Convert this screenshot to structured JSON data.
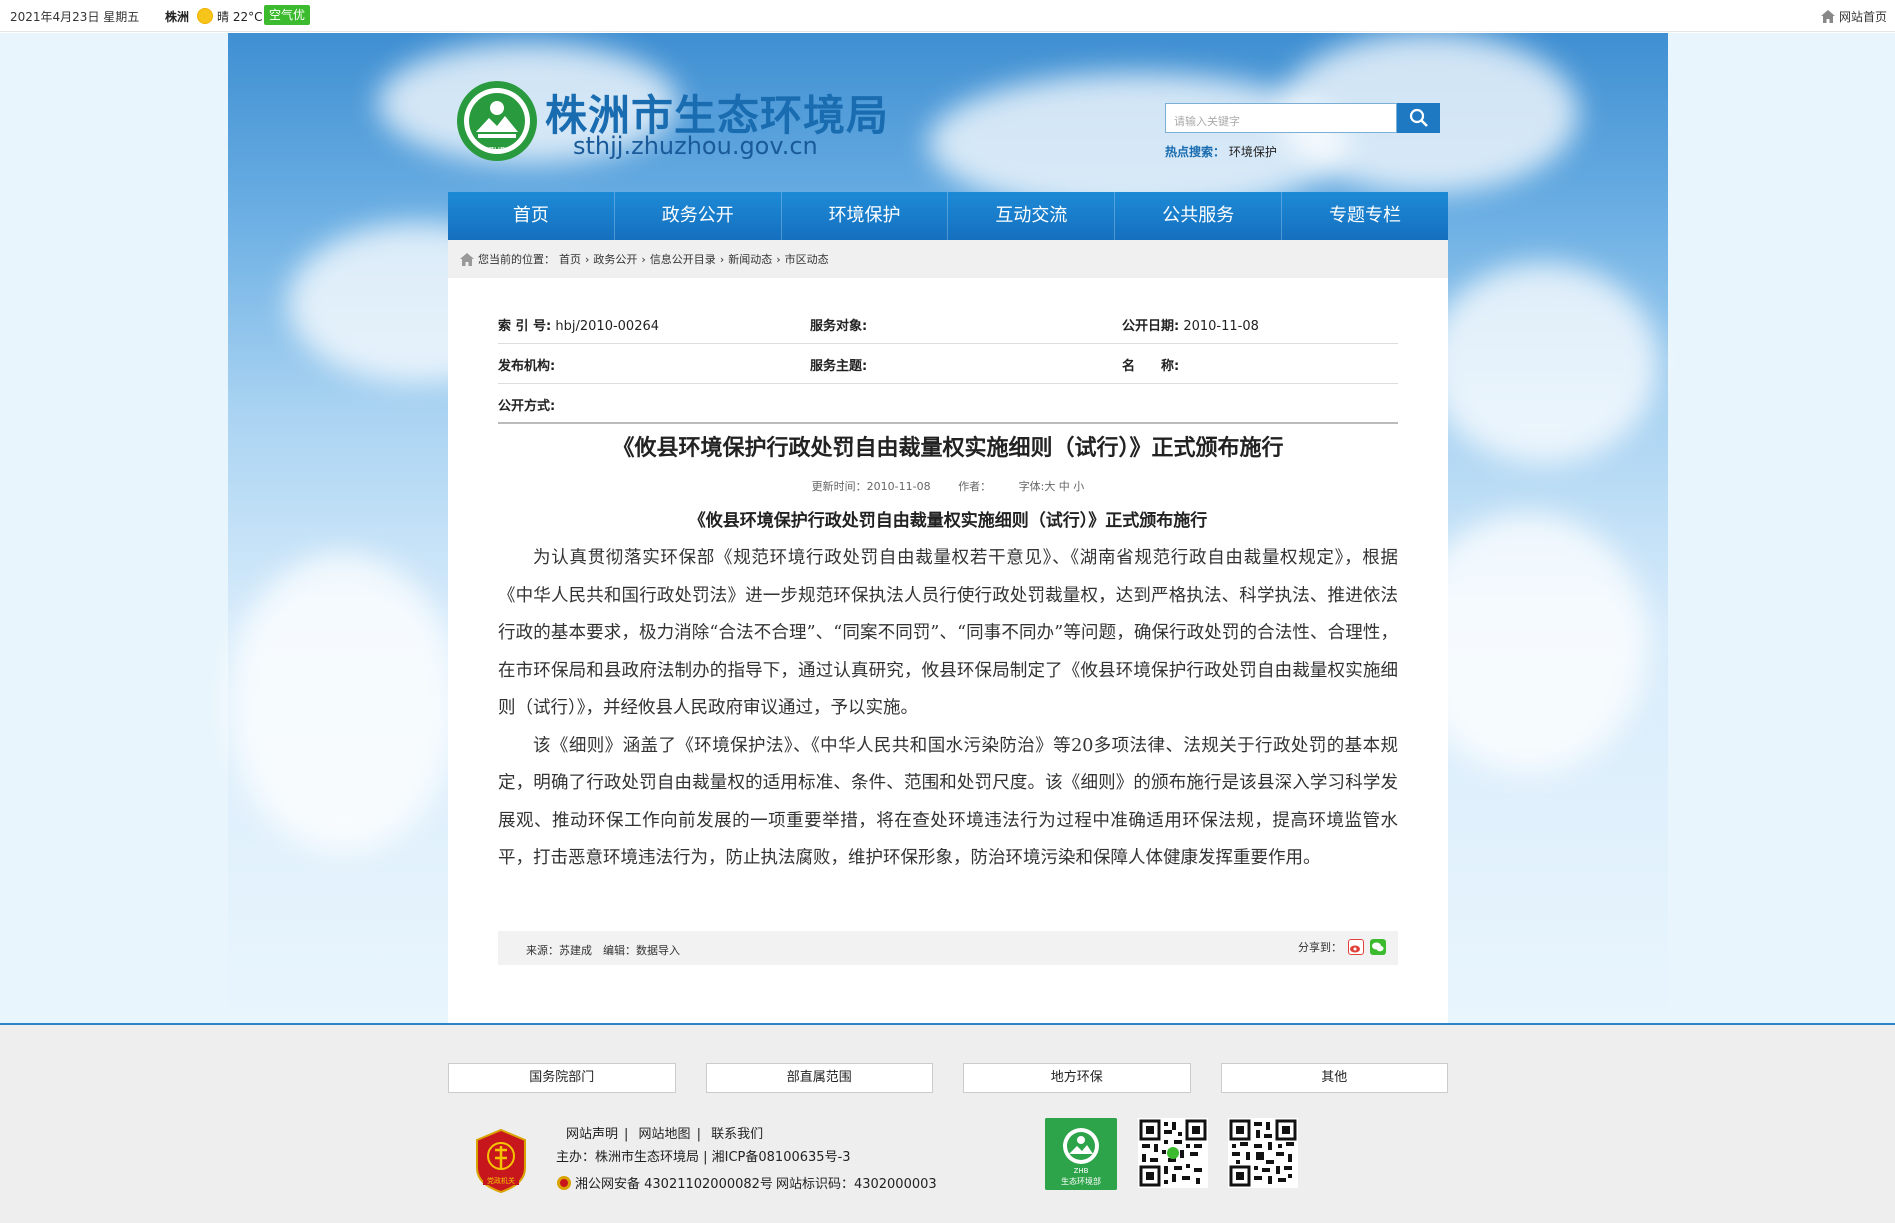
{
  "topbar": {
    "date": "2021年4月23日 星期五",
    "city": "株洲",
    "weather": "晴 22°C",
    "aqi": "空气优",
    "home_link": "网站首页"
  },
  "header": {
    "title": "株洲市生态环境局",
    "url": "sthjj.zhuzhou.gov.cn",
    "logo_text": "ZHB",
    "search_placeholder": "请输入关键字",
    "hot_label": "热点搜索：",
    "hot_keyword": "环境保护"
  },
  "nav": {
    "items": [
      "首页",
      "政务公开",
      "环境保护",
      "互动交流",
      "公共服务",
      "专题专栏"
    ]
  },
  "breadcrumb": {
    "prefix": "您当前的位置：",
    "items": [
      "首页",
      "政务公开",
      "信息公开目录",
      "新闻动态",
      "市区动态"
    ],
    "separator": "›"
  },
  "meta": {
    "index_label": "索 引 号:",
    "index_value": "hbj/2010-00264",
    "target_label": "服务对象:",
    "target_value": "",
    "date_label": "公开日期:",
    "date_value": "2010-11-08",
    "org_label": "发布机构:",
    "org_value": "",
    "topic_label": "服务主题:",
    "topic_value": "",
    "name_label": "名　　称:",
    "name_value": "",
    "mode_label": "公开方式:",
    "mode_value": ""
  },
  "article": {
    "title": "《攸县环境保护行政处罚自由裁量权实施细则（试行）》正式颁布施行",
    "update_time": "更新时间：2010-11-08",
    "author": "作者：",
    "font_size": "字体:大 中 小",
    "subtitle": "《攸县环境保护行政处罚自由裁量权实施细则（试行）》正式颁布施行",
    "paragraphs": [
      "为认真贯彻落实环保部《规范环境行政处罚自由裁量权若干意见》、《湖南省规范行政自由裁量权规定》，根据《中华人民共和国行政处罚法》进一步规范环保执法人员行使行政处罚裁量权，达到严格执法、科学执法、推进依法行政的基本要求，极力消除“合法不合理”、“同案不同罚”、“同事不同办”等问题，确保行政处罚的合法性、合理性，在市环保局和县政府法制办的指导下，通过认真研究，攸县环保局制定了《攸县环境保护行政处罚自由裁量权实施细则（试行）》，并经攸县人民政府审议通过，予以实施。",
      "该《细则》涵盖了《环境保护法》、《中华人民共和国水污染防治》等20多项法律、法规关于行政处罚的基本规定，明确了行政处罚自由裁量权的适用标准、条件、范围和处罚尺度。该《细则》的颁布施行是该县深入学习科学发展观、推动环保工作向前发展的一项重要举措，将在查处环境违法行为过程中准确适用环保法规，提高环境监管水平，打击恶意环境违法行为，防止执法腐败，维护环保形象，防治环境污染和保障人体健康发挥重要作用。"
    ],
    "source": "来源：苏建成　编辑：数据导入",
    "share_label": "分享到："
  },
  "footer": {
    "link_groups": [
      "国务院部门",
      "部直属范围",
      "地方环保",
      "其他"
    ],
    "nav_links": [
      "网站声明",
      "网站地图",
      "联系我们"
    ],
    "host": "主办：株洲市生态环境局 | 湘ICP备08100635号-3",
    "police": "湘公网安备 43021102000082号",
    "site_code": "网站标识码：4302000003",
    "badge_text": "党政机关",
    "hb_logo_text": "生态环境部",
    "hb_logo_abbr": "ZHB"
  }
}
